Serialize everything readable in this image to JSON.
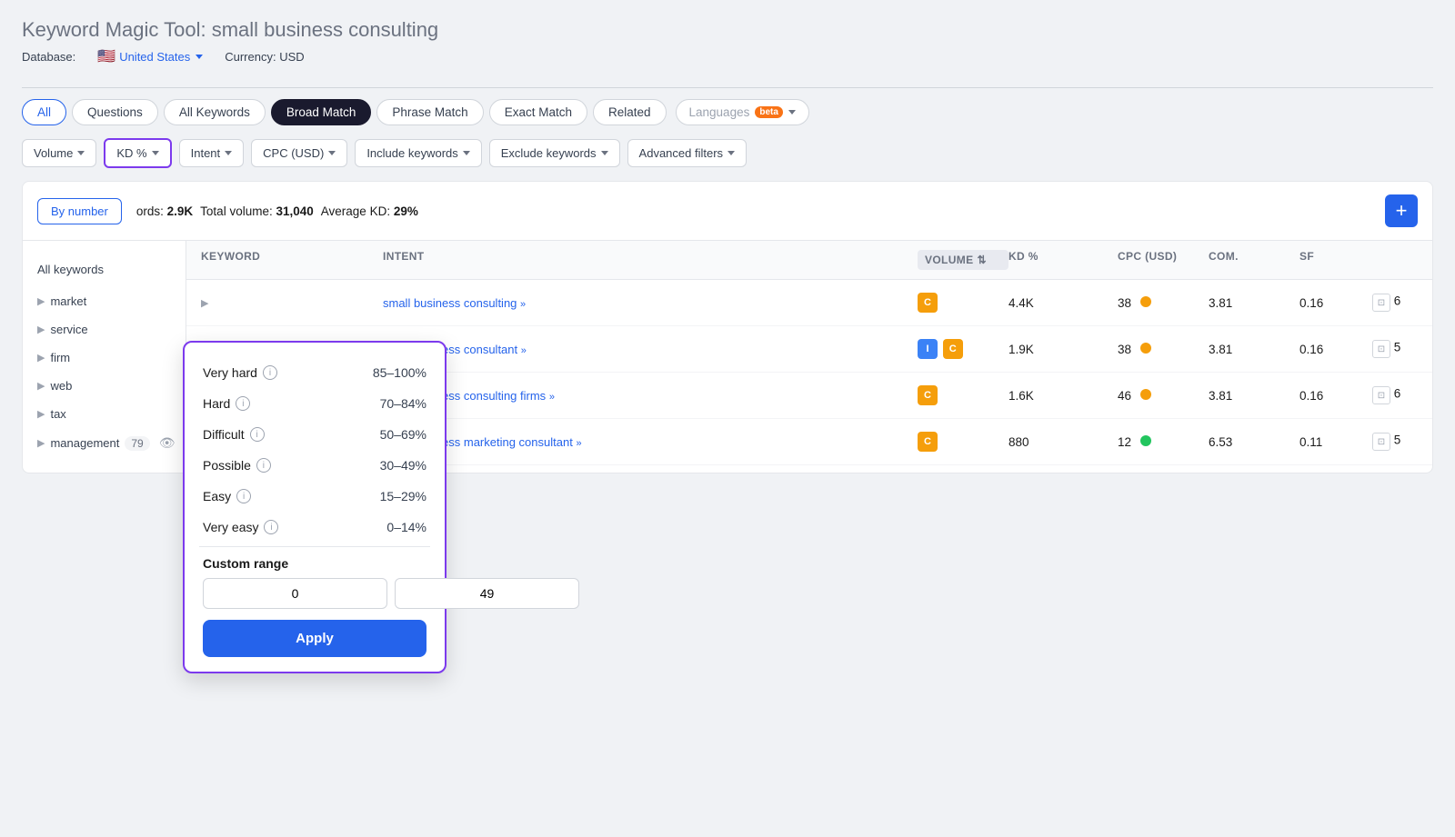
{
  "page": {
    "title_static": "Keyword Magic Tool:",
    "title_query": "small business consulting",
    "database_label": "Database:",
    "database_country": "United States",
    "currency_label": "Currency: USD"
  },
  "tabs": [
    {
      "label": "All",
      "state": "active-blue"
    },
    {
      "label": "Questions",
      "state": "normal"
    },
    {
      "label": "All Keywords",
      "state": "normal"
    },
    {
      "label": "Broad Match",
      "state": "active-dark"
    },
    {
      "label": "Phrase Match",
      "state": "normal"
    },
    {
      "label": "Exact Match",
      "state": "normal"
    },
    {
      "label": "Related",
      "state": "normal"
    }
  ],
  "languages_btn": "Languages",
  "beta_label": "beta",
  "filters": [
    {
      "label": "Volume",
      "active": false
    },
    {
      "label": "KD %",
      "active": true
    },
    {
      "label": "Intent",
      "active": false
    },
    {
      "label": "CPC (USD)",
      "active": false
    },
    {
      "label": "Include keywords",
      "active": false
    },
    {
      "label": "Exclude keywords",
      "active": false
    },
    {
      "label": "Advanced filters",
      "active": false
    }
  ],
  "stats": {
    "total_keywords_label": "ords:",
    "total_keywords": "2.9K",
    "total_volume_label": "Total volume:",
    "total_volume": "31,040",
    "avg_kd_label": "Average KD:",
    "avg_kd": "29%"
  },
  "by_number_label": "By number",
  "add_icon": "+",
  "table_headers": {
    "keyword": "keyword",
    "intent": "Intent",
    "volume": "Volume",
    "kd_pct": "KD %",
    "cpc": "CPC (USD)",
    "com": "Com.",
    "sf": "SF"
  },
  "left_panel": {
    "all_keywords": "All keywords",
    "groups": [
      {
        "label": "market"
      },
      {
        "label": "service"
      },
      {
        "label": "firm"
      },
      {
        "label": "web"
      },
      {
        "label": "tax"
      },
      {
        "label": "management",
        "count": "79"
      }
    ]
  },
  "table_rows": [
    {
      "keyword": "small business consulting",
      "chevron": "»",
      "intent": [
        "C"
      ],
      "volume": "4.4K",
      "kd": "38",
      "kd_dot": "yellow",
      "cpc": "3.81",
      "com": "0.16",
      "sf": "6"
    },
    {
      "keyword": "small business consultant",
      "chevron": "»",
      "intent": [
        "I",
        "C"
      ],
      "volume": "1.9K",
      "kd": "38",
      "kd_dot": "yellow",
      "cpc": "3.81",
      "com": "0.16",
      "sf": "5"
    },
    {
      "keyword": "small business consulting firms",
      "chevron": "»",
      "intent": [
        "C"
      ],
      "volume": "1.6K",
      "kd": "46",
      "kd_dot": "yellow",
      "cpc": "3.81",
      "com": "0.16",
      "sf": "6"
    },
    {
      "keyword": "small business marketing consultant",
      "chevron": "»",
      "intent": [
        "C"
      ],
      "volume": "880",
      "kd": "12",
      "kd_dot": "green",
      "cpc": "6.53",
      "com": "0.11",
      "sf": "5"
    }
  ],
  "kd_dropdown": {
    "options": [
      {
        "label": "Very hard",
        "range": "85–100%"
      },
      {
        "label": "Hard",
        "range": "70–84%"
      },
      {
        "label": "Difficult",
        "range": "50–69%"
      },
      {
        "label": "Possible",
        "range": "30–49%"
      },
      {
        "label": "Easy",
        "range": "15–29%"
      },
      {
        "label": "Very easy",
        "range": "0–14%"
      }
    ],
    "custom_range_label": "Custom range",
    "input_from": "0",
    "input_to": "49",
    "apply_label": "Apply"
  }
}
